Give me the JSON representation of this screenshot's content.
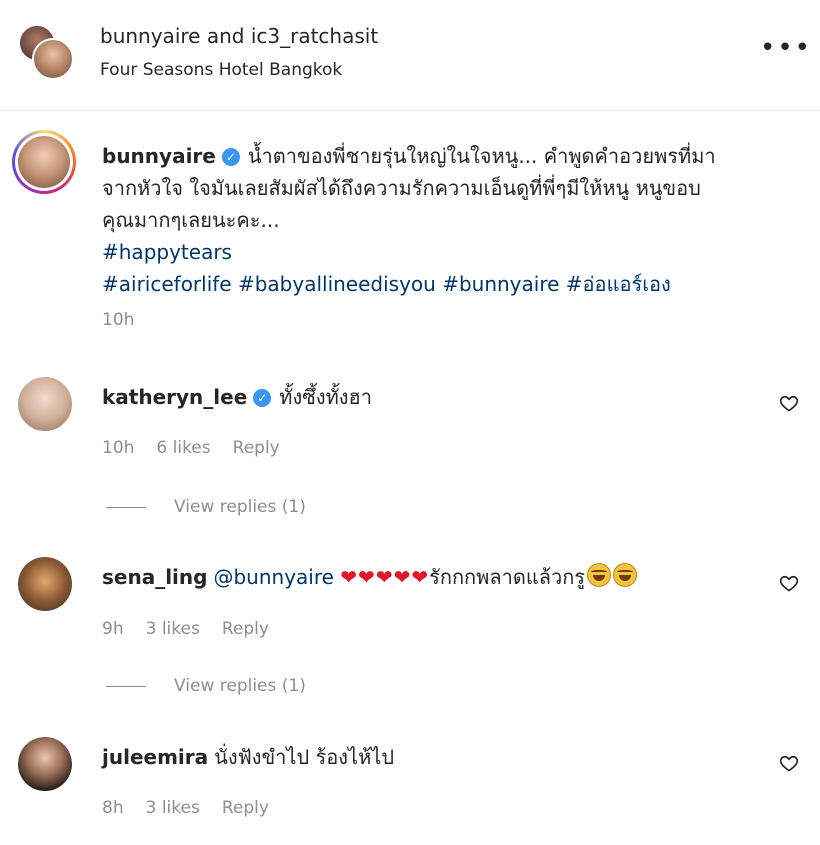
{
  "header": {
    "user1": "bunnyaire",
    "conj": "and",
    "user2": "ic3_ratchasit",
    "location": "Four Seasons Hotel Bangkok",
    "more_icon": "more-horizontal-icon"
  },
  "caption": {
    "username": "bunnyaire",
    "verified_icon": "verified-badge-icon",
    "line1": "น้ำตาของพี่ชายรุ่นใหญ่ในใจหนู... คำพูดคำอวยพรที่มา",
    "line2": "จากหัวใจ ใจมันเลยสัมผัสได้ถึงความรักความเอ็นดูที่พี่ๆมีให้หนู หนูขอบ",
    "line3": "คุณมากๆเลยนะคะ...",
    "hashtags_line1": "#happytears",
    "hashtags_line2": [
      "#airiceforlife",
      "#babyallineedisyou",
      "#bunnyaire",
      "#อ่อแอร์เอง"
    ],
    "time": "10h"
  },
  "comments": [
    {
      "username": "katheryn_lee",
      "verified": true,
      "text": "ทั้งซึ้งทั้งฮา",
      "time": "10h",
      "likes": "6 likes",
      "reply": "Reply",
      "view_replies": "View replies (1)"
    },
    {
      "username": "sena_ling",
      "verified": false,
      "mention": "@bunnyaire",
      "hearts": "❤❤❤❤❤",
      "text": "รักกกพลาดแล้วกรู",
      "time": "9h",
      "likes": "3 likes",
      "reply": "Reply",
      "view_replies": "View replies (1)"
    },
    {
      "username": "juleemira",
      "verified": false,
      "text": "นั่งฟังขำไป ร้องไห้ไป",
      "time": "8h",
      "likes": "3 likes",
      "reply": "Reply"
    }
  ],
  "icons": {
    "like": "heart-outline-icon"
  }
}
